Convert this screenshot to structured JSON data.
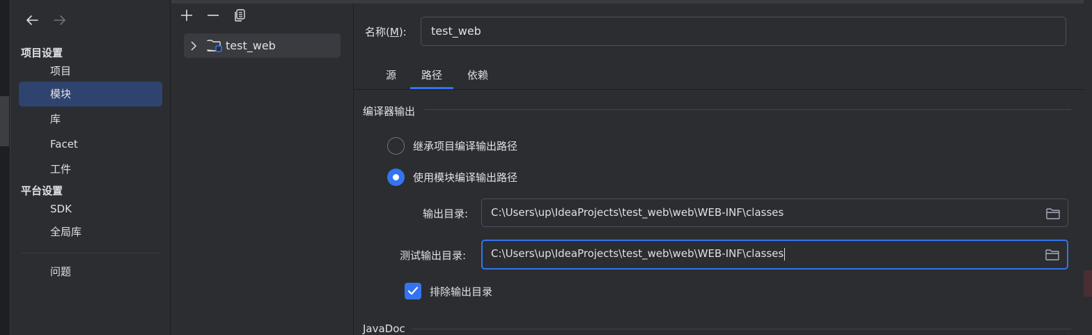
{
  "nav": {
    "back_icon": "arrow-left-icon",
    "forward_icon": "arrow-right-icon",
    "sections": [
      {
        "title": "项目设置"
      },
      {
        "title": "平台设置"
      }
    ],
    "items": [
      {
        "label": "项目"
      },
      {
        "label": "模块"
      },
      {
        "label": "库"
      },
      {
        "label": "Facet"
      },
      {
        "label": "工件"
      },
      {
        "label": "SDK"
      },
      {
        "label": "全局库"
      },
      {
        "label": "问题"
      }
    ],
    "selected": "模块"
  },
  "tree": {
    "toolbar": [
      "add-icon",
      "remove-icon",
      "copy-icon"
    ],
    "node_label": "test_web"
  },
  "detail": {
    "name_label": "名称(M):",
    "name_label_prefix": "名称(",
    "name_label_mnemonic": "M",
    "name_label_suffix": "):",
    "name_value": "test_web",
    "tabs": [
      {
        "label": "源"
      },
      {
        "label": "路径"
      },
      {
        "label": "依赖"
      }
    ],
    "active_tab": "路径",
    "compiler_output_title": "编译器输出",
    "radio_inherit": "继承项目编译输出路径",
    "radio_module": "使用模块编译输出路径",
    "output_dir_label": "输出目录:",
    "output_dir_value": "C:\\Users\\up\\IdeaProjects\\test_web\\web\\WEB-INF\\classes",
    "test_output_dir_label": "测试输出目录:",
    "test_output_dir_value": "C:\\Users\\up\\IdeaProjects\\test_web\\web\\WEB-INF\\classes",
    "exclude_output_label": "排除输出目录",
    "exclude_output_checked": true,
    "javadoc_title": "JavaDoc"
  },
  "colors": {
    "accent": "#3574f0",
    "selection": "#2e436e",
    "background": "#2b2d30"
  }
}
